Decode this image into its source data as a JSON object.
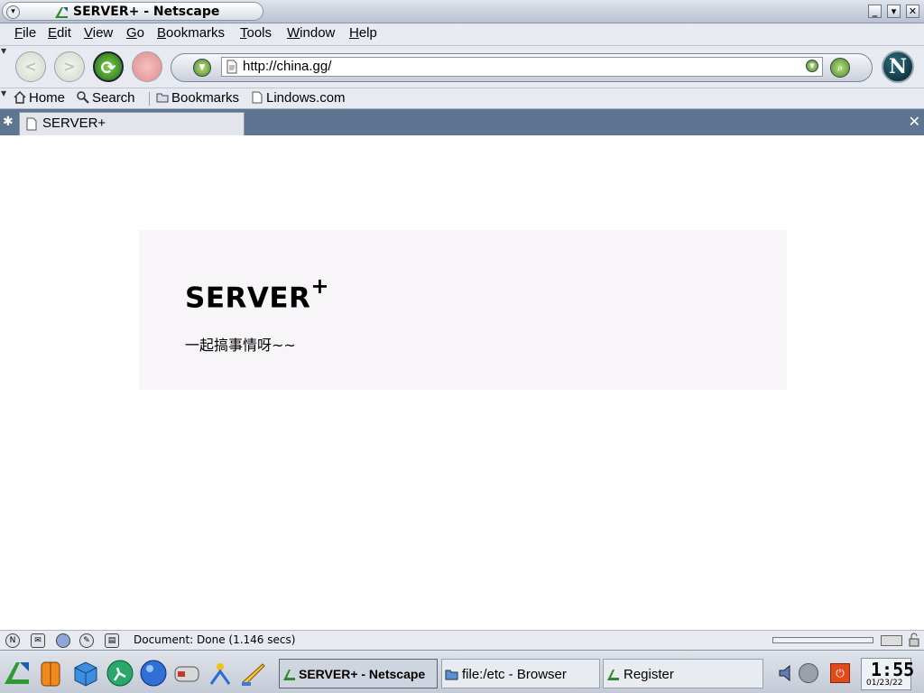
{
  "window": {
    "title": "SERVER+ - Netscape"
  },
  "menu": {
    "items": [
      "File",
      "Edit",
      "View",
      "Go",
      "Bookmarks",
      "Tools",
      "Window",
      "Help"
    ]
  },
  "navigation": {
    "url": "http://china.gg/",
    "throbber_letter": "N"
  },
  "personal_toolbar": {
    "items": [
      "Home",
      "Search",
      "Bookmarks",
      "Lindows.com"
    ]
  },
  "tabs": {
    "active_label": "SERVER+"
  },
  "page": {
    "title_main": "SERVER",
    "title_sup": "+",
    "tagline": "一起搞事情呀~~"
  },
  "statusbar": {
    "text": "Document: Done (1.146 secs)"
  },
  "taskbar": {
    "tasks": [
      "SERVER+ - Netscape",
      "file:/etc - Browser",
      "Register"
    ],
    "clock_time": "1:55",
    "clock_date": "01/23/22"
  },
  "colors": {
    "tab_strip": "#5d7590",
    "hero_box": "#f7f5f8",
    "chrome_bg": "#e7eaf0"
  }
}
